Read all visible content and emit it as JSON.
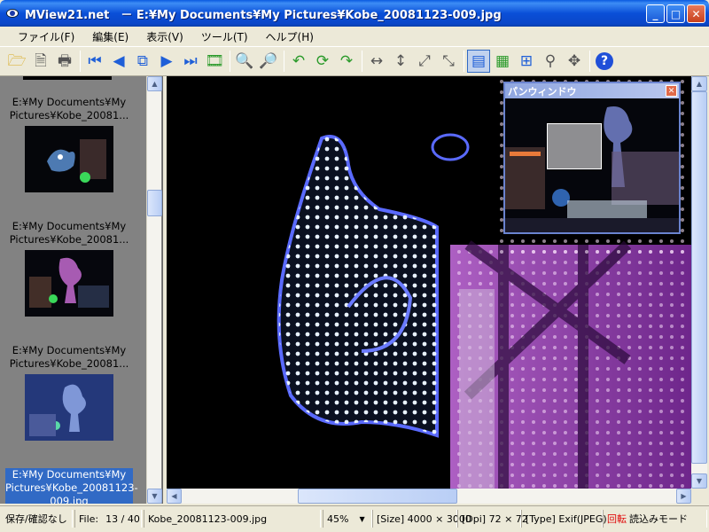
{
  "window": {
    "title": "MView21.net　－ E:¥My Documents¥My Pictures¥Kobe_20081123-009.jpg",
    "minimize": "_",
    "maximize": "□",
    "close": "✕"
  },
  "menu": {
    "items": [
      "ファイル(F)",
      "編集(E)",
      "表示(V)",
      "ツール(T)",
      "ヘルプ(H)"
    ]
  },
  "toolbar": {
    "icons": [
      "open-folder-icon",
      "open-file-icon",
      "print-icon",
      "first-image-icon",
      "previous-image-icon",
      "copy-image-icon",
      "next-image-icon",
      "last-image-icon",
      "slideshow-icon",
      "zoom-in-icon",
      "zoom-out-icon",
      "rotate-left-icon",
      "rotate-icon",
      "rotate-right-icon",
      "fit-width-icon",
      "fit-height-icon",
      "fit-window-icon",
      "actual-size-icon",
      "thumbnail-view-icon",
      "map-view-icon",
      "grid-view-icon",
      "pin-icon",
      "move-icon",
      "help-icon"
    ]
  },
  "thumbnails": {
    "items": [
      {
        "caption": "E:¥My Documents¥My Pictures¥Kobe_20081...",
        "selected": false
      },
      {
        "caption": "E:¥My Documents¥My Pictures¥Kobe_20081...",
        "selected": false
      },
      {
        "caption": "E:¥My Documents¥My Pictures¥Kobe_20081...",
        "selected": false
      },
      {
        "caption": "E:¥My Documents¥My Pictures¥Kobe_20081123-009.jpg",
        "selected": true
      }
    ]
  },
  "pan_window": {
    "title": "パンウィンドウ",
    "close": "✕"
  },
  "status": {
    "save_state": "保存/確認なし",
    "file_label": "File:",
    "file_position": "13 / 40",
    "filename": "Kobe_20081123-009.jpg",
    "zoom": "45%",
    "size": "[Size] 4000 × 3000",
    "dpi": "[Dpi] 72 × 72",
    "type": "[Type] Exif(JPEG)",
    "rotation": "回転",
    "read_mode": "読込みモード"
  },
  "colors": {
    "titlebar": "#0a4fd8",
    "selection": "#316ac5",
    "thumb_panel": "#828282",
    "rotation_text": "#e01010"
  }
}
